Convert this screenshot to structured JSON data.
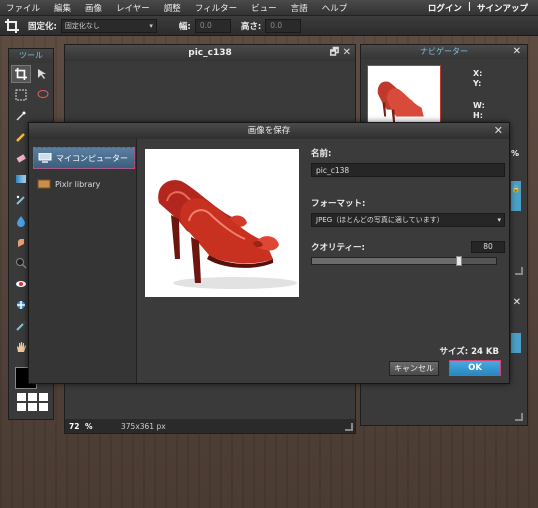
{
  "menubar": {
    "items": [
      "ファイル",
      "編集",
      "画像",
      "レイヤー",
      "調整",
      "フィルター",
      "ビュー",
      "言語",
      "ヘルプ"
    ],
    "login": "ログイン",
    "separator": "|",
    "signup": "サインアップ"
  },
  "options": {
    "crop_label": "固定化:",
    "crop_select": "固定化なし",
    "width_label": "幅:",
    "width_value": "0.0",
    "height_label": "高さ:",
    "height_value": "0.0"
  },
  "tools": {
    "title": "ツール",
    "fg_color": "#000000",
    "bg_color": "#ffffff"
  },
  "document": {
    "title": "pic_c138",
    "zoom": "72",
    "zoom_unit": "%",
    "dimensions": "375x361 px"
  },
  "navigator": {
    "title": "ナビゲーター",
    "x_label": "X:",
    "y_label": "Y:",
    "w_label": "W:",
    "h_label": "H:",
    "zoom_unit": "%"
  },
  "dialog": {
    "title": "画像を保存",
    "locations": [
      {
        "label": "マイコンピューター",
        "icon": "computer-icon"
      },
      {
        "label": "Pixlr library",
        "icon": "library-icon"
      }
    ],
    "name_label": "名前:",
    "name_value": "pic_c138",
    "format_label": "フォーマット:",
    "format_value": "JPEG（ほとんどの写真に適しています）",
    "quality_label": "クオリティー:",
    "quality_value": "80",
    "quality_fraction": 0.8,
    "size_text": "サイズ: 24 KB",
    "cancel_label": "キャンセル",
    "ok_label": "OK"
  },
  "colors": {
    "accent_blue": "#4aa0c8",
    "focus_pink": "#d0457a",
    "shoe_red": "#c0392b"
  }
}
